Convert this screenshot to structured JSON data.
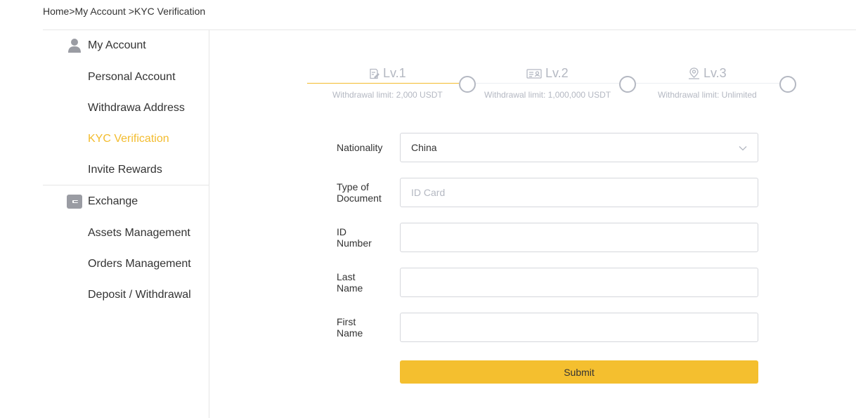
{
  "breadcrumb": {
    "home": "Home",
    "sep1": ">",
    "my_account": "My Account ",
    "sep2": ">",
    "current": "KYC Verification"
  },
  "sidebar": {
    "my_account": {
      "label": "My Account",
      "icon": "person-icon"
    },
    "account_items": [
      {
        "label": "Personal Account"
      },
      {
        "label": "Withdrawa Address"
      },
      {
        "label": "KYC Verification",
        "active": true
      },
      {
        "label": "Invite Rewards"
      }
    ],
    "exchange": {
      "label": "Exchange",
      "icon": "wallet-icon"
    },
    "exchange_items": [
      {
        "label": "Assets Management"
      },
      {
        "label": "Orders Management"
      },
      {
        "label": "Deposit / Withdrawal"
      }
    ]
  },
  "steps": [
    {
      "title": "Lv.1",
      "subtitle": "Withdrawal limit: 2,000 USDT",
      "icon": "edit-document-icon"
    },
    {
      "title": "Lv.2",
      "subtitle": "Withdrawal limit: 1,000,000 USDT",
      "icon": "id-card-icon"
    },
    {
      "title": "Lv.3",
      "subtitle": "Withdrawal limit: Unlimited",
      "icon": "location-person-icon"
    }
  ],
  "form": {
    "nationality": {
      "label": "Nationality",
      "value": "China"
    },
    "document_type": {
      "label_line1": "Type of",
      "label_line2": "Document",
      "placeholder": "ID Card"
    },
    "id_number": {
      "label_line1": "ID",
      "label_line2": "Number",
      "value": ""
    },
    "last_name": {
      "label_line1": "Last",
      "label_line2": "Name",
      "value": ""
    },
    "first_name": {
      "label_line1": "First",
      "label_line2": "Name",
      "value": ""
    },
    "submit_label": "Submit"
  },
  "colors": {
    "accent": "#f3bc2e",
    "button": "#f4bf2f",
    "muted": "#b4b8c2",
    "border": "#d5d7dc"
  }
}
